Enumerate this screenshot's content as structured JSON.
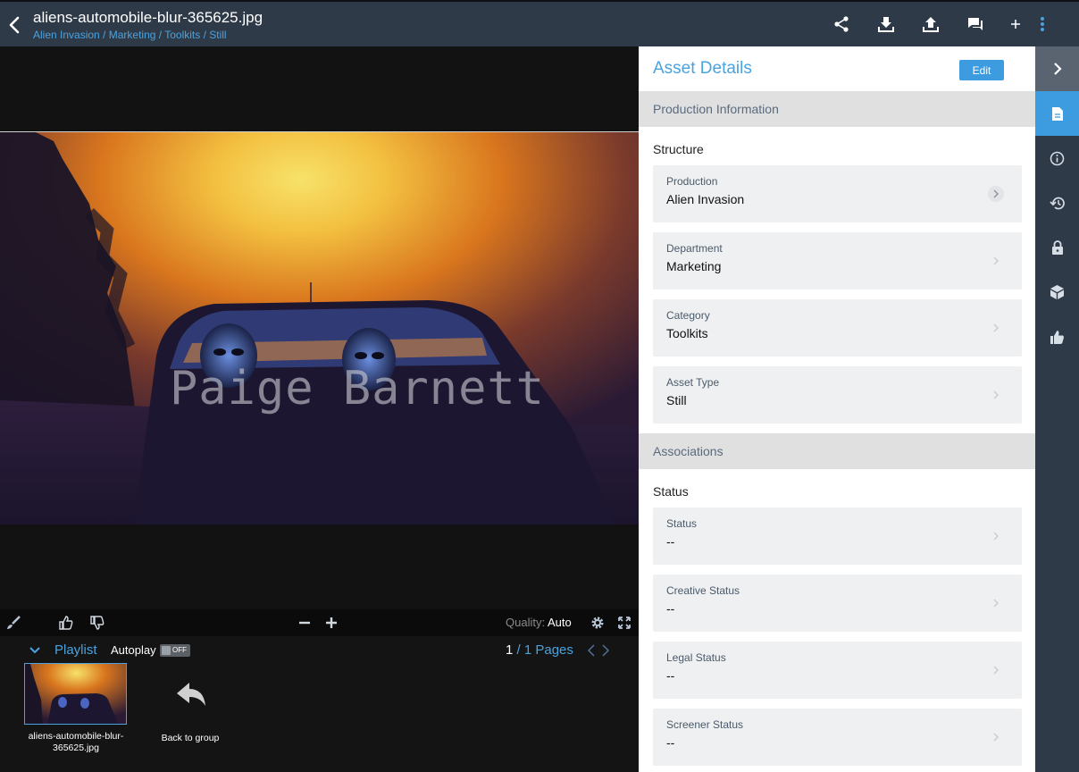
{
  "header": {
    "title": "aliens-automobile-blur-365625.jpg",
    "breadcrumb": [
      "Alien Invasion",
      "Marketing",
      "Toolkits",
      "Still"
    ],
    "breadcrumb_sep": " / ",
    "actions": [
      "share-icon",
      "download-icon",
      "upload-icon",
      "comment-icon",
      "plus-icon",
      "more-vertical-icon"
    ]
  },
  "viewer": {
    "watermark": "Paige Barnett",
    "toolbar": {
      "quality_label": "Quality:",
      "quality_value": "Auto",
      "icons": [
        "annotate-brush-icon",
        "thumbs-up-icon",
        "thumbs-down-icon",
        "zoom-out-icon",
        "zoom-in-icon",
        "settings-gear-icon",
        "fullscreen-icon"
      ]
    }
  },
  "playlist": {
    "label": "Playlist",
    "autoplay_label": "Autoplay",
    "autoplay_state": "OFF",
    "page_current": "1",
    "page_total_text": "/ 1 Pages",
    "items": [
      {
        "caption": "aliens-automobile-blur-365625.jpg"
      }
    ],
    "back_to_group": "Back to group"
  },
  "details": {
    "title": "Asset Details",
    "edit_label": "Edit",
    "sections": [
      {
        "heading": "Production Information",
        "group": "Structure",
        "fields": [
          {
            "label": "Production",
            "value": "Alien Invasion"
          },
          {
            "label": "Department",
            "value": "Marketing"
          },
          {
            "label": "Category",
            "value": "Toolkits"
          },
          {
            "label": "Asset Type",
            "value": "Still"
          }
        ]
      },
      {
        "heading": "Associations",
        "group": "Status",
        "fields": [
          {
            "label": "Status",
            "value": "--"
          },
          {
            "label": "Creative Status",
            "value": "--"
          },
          {
            "label": "Legal Status",
            "value": "--"
          },
          {
            "label": "Screener Status",
            "value": "--"
          }
        ]
      }
    ]
  },
  "rail": {
    "items": [
      "collapse-chevron-icon",
      "document-icon",
      "info-icon",
      "history-icon",
      "lock-icon",
      "package-icon",
      "thumbs-up-icon"
    ],
    "active": "document-icon"
  },
  "colors": {
    "accent": "#4aa3df",
    "topbar": "#2f3a48",
    "edit_button": "#3d9be0"
  }
}
